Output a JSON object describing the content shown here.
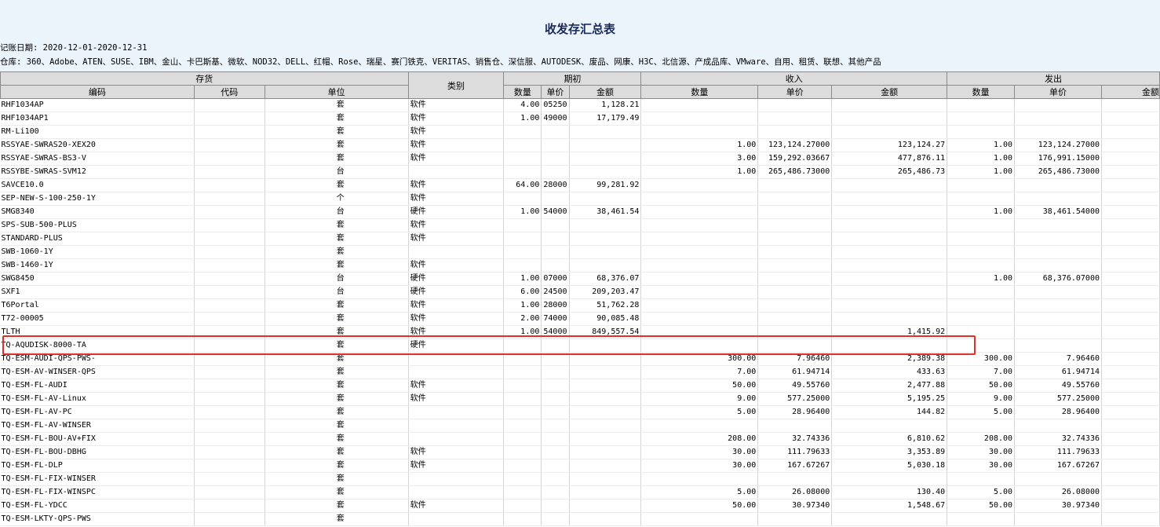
{
  "report": {
    "title": "收发存汇总表",
    "period": "记账日期: 2020-12-01-2020-12-31",
    "warehouses": "仓库: 360、Adobe、ATEN、SUSE、IBM、金山、卡巴斯基、微软、NOD32、DELL、红帽、Rose、瑞星、赛门铁克、VERITAS、销售仓、深信服、AUTODESK、废品、网康、H3C、北信源、产成品库、VMware、自用、租赁、联想、其他产品"
  },
  "headers": {
    "inventory": "存货",
    "category": "类别",
    "opening": "期初",
    "receipts": "收入",
    "issues": "发出",
    "code": "编码",
    "alias": "代码",
    "unit": "单位",
    "qty": "数量",
    "price": "单价",
    "amount": "金额"
  },
  "rows": [
    {
      "code": "RHF1034AP",
      "unit": "套",
      "category": "软件",
      "o_qty": "4.00",
      "o_price": "05250",
      "o_amt": "1,128.21",
      "r_qty": "",
      "r_price": "",
      "r_amt": "",
      "i_qty": "",
      "i_price": ""
    },
    {
      "code": "RHF1034AP1",
      "unit": "套",
      "category": "软件",
      "o_qty": "1.00",
      "o_price": "49000",
      "o_amt": "17,179.49",
      "r_qty": "",
      "r_price": "",
      "r_amt": "",
      "i_qty": "",
      "i_price": ""
    },
    {
      "code": "RM-Li100",
      "unit": "套",
      "category": "软件",
      "o_qty": "",
      "o_price": "",
      "o_amt": "",
      "r_qty": "",
      "r_price": "",
      "r_amt": "",
      "i_qty": "",
      "i_price": ""
    },
    {
      "code": "RSSYAE-SWRAS20-XEX20",
      "unit": "套",
      "category": "软件",
      "o_qty": "",
      "o_price": "",
      "o_amt": "",
      "r_qty": "1.00",
      "r_price": "123,124.27000",
      "r_amt": "123,124.27",
      "i_qty": "1.00",
      "i_price": "123,124.27000"
    },
    {
      "code": "RSSYAE-SWRAS-BS3-V",
      "unit": "套",
      "category": "软件",
      "o_qty": "",
      "o_price": "",
      "o_amt": "",
      "r_qty": "3.00",
      "r_price": "159,292.03667",
      "r_amt": "477,876.11",
      "i_qty": "1.00",
      "i_price": "176,991.15000"
    },
    {
      "code": "RSSYBE-SWRAS-SVM12",
      "unit": "台",
      "category": "",
      "o_qty": "",
      "o_price": "",
      "o_amt": "",
      "r_qty": "1.00",
      "r_price": "265,486.73000",
      "r_amt": "265,486.73",
      "i_qty": "1.00",
      "i_price": "265,486.73000"
    },
    {
      "code": "SAVCE10.0",
      "unit": "套",
      "category": "软件",
      "o_qty": "64.00",
      "o_price": "28000",
      "o_amt": "99,281.92",
      "r_qty": "",
      "r_price": "",
      "r_amt": "",
      "i_qty": "",
      "i_price": ""
    },
    {
      "code": "SEP-NEW-S-100-250-1Y",
      "unit": "个",
      "category": "软件",
      "o_qty": "",
      "o_price": "",
      "o_amt": "",
      "r_qty": "",
      "r_price": "",
      "r_amt": "",
      "i_qty": "",
      "i_price": ""
    },
    {
      "code": "SMG8340",
      "unit": "台",
      "category": "硬件",
      "o_qty": "1.00",
      "o_price": "54000",
      "o_amt": "38,461.54",
      "r_qty": "",
      "r_price": "",
      "r_amt": "",
      "i_qty": "1.00",
      "i_price": "38,461.54000"
    },
    {
      "code": "SPS-SUB-500-PLUS",
      "unit": "套",
      "category": "软件",
      "o_qty": "",
      "o_price": "",
      "o_amt": "",
      "r_qty": "",
      "r_price": "",
      "r_amt": "",
      "i_qty": "",
      "i_price": ""
    },
    {
      "code": "STANDARD-PLUS",
      "unit": "套",
      "category": "软件",
      "o_qty": "",
      "o_price": "",
      "o_amt": "",
      "r_qty": "",
      "r_price": "",
      "r_amt": "",
      "i_qty": "",
      "i_price": ""
    },
    {
      "code": "SWB-1060-1Y",
      "unit": "套",
      "category": "",
      "o_qty": "",
      "o_price": "",
      "o_amt": "",
      "r_qty": "",
      "r_price": "",
      "r_amt": "",
      "i_qty": "",
      "i_price": ""
    },
    {
      "code": "SWB-1460-1Y",
      "unit": "套",
      "category": "软件",
      "o_qty": "",
      "o_price": "",
      "o_amt": "",
      "r_qty": "",
      "r_price": "",
      "r_amt": "",
      "i_qty": "",
      "i_price": ""
    },
    {
      "code": "SWG8450",
      "unit": "台",
      "category": "硬件",
      "o_qty": "1.00",
      "o_price": "07000",
      "o_amt": "68,376.07",
      "r_qty": "",
      "r_price": "",
      "r_amt": "",
      "i_qty": "1.00",
      "i_price": "68,376.07000"
    },
    {
      "code": "SXF1",
      "unit": "台",
      "category": "硬件",
      "o_qty": "6.00",
      "o_price": "24500",
      "o_amt": "209,203.47",
      "r_qty": "",
      "r_price": "",
      "r_amt": "",
      "i_qty": "",
      "i_price": ""
    },
    {
      "code": "T6Portal",
      "unit": "套",
      "category": "软件",
      "o_qty": "1.00",
      "o_price": "28000",
      "o_amt": "51,762.28",
      "r_qty": "",
      "r_price": "",
      "r_amt": "",
      "i_qty": "",
      "i_price": ""
    },
    {
      "code": "T72-00005",
      "unit": "套",
      "category": "软件",
      "o_qty": "2.00",
      "o_price": "74000",
      "o_amt": "90,085.48",
      "r_qty": "",
      "r_price": "",
      "r_amt": "",
      "i_qty": "",
      "i_price": ""
    },
    {
      "code": "TLTH",
      "unit": "套",
      "category": "软件",
      "o_qty": "1.00",
      "o_price": "54000",
      "o_amt": "849,557.54",
      "r_qty": "",
      "r_price": "",
      "r_amt": "1,415.92",
      "i_qty": "",
      "i_price": ""
    },
    {
      "code": "TQ-AQUDISK-8000-TA",
      "unit": "套",
      "category": "硬件",
      "o_qty": "",
      "o_price": "",
      "o_amt": "",
      "r_qty": "",
      "r_price": "",
      "r_amt": "",
      "i_qty": "",
      "i_price": ""
    },
    {
      "code": "TQ-ESM-AUDI-QPS-PWS-",
      "unit": "套",
      "category": "",
      "o_qty": "",
      "o_price": "",
      "o_amt": "",
      "r_qty": "300.00",
      "r_price": "7.96460",
      "r_amt": "2,389.38",
      "i_qty": "300.00",
      "i_price": "7.96460"
    },
    {
      "code": "TQ-ESM-AV-WINSER-QPS",
      "unit": "套",
      "category": "",
      "o_qty": "",
      "o_price": "",
      "o_amt": "",
      "r_qty": "7.00",
      "r_price": "61.94714",
      "r_amt": "433.63",
      "i_qty": "7.00",
      "i_price": "61.94714"
    },
    {
      "code": "TQ-ESM-FL-AUDI",
      "unit": "套",
      "category": "软件",
      "o_qty": "",
      "o_price": "",
      "o_amt": "",
      "r_qty": "50.00",
      "r_price": "49.55760",
      "r_amt": "2,477.88",
      "i_qty": "50.00",
      "i_price": "49.55760"
    },
    {
      "code": "TQ-ESM-FL-AV-Linux",
      "unit": "套",
      "category": "软件",
      "o_qty": "",
      "o_price": "",
      "o_amt": "",
      "r_qty": "9.00",
      "r_price": "577.25000",
      "r_amt": "5,195.25",
      "i_qty": "9.00",
      "i_price": "577.25000"
    },
    {
      "code": "TQ-ESM-FL-AV-PC",
      "unit": "套",
      "category": "",
      "o_qty": "",
      "o_price": "",
      "o_amt": "",
      "r_qty": "5.00",
      "r_price": "28.96400",
      "r_amt": "144.82",
      "i_qty": "5.00",
      "i_price": "28.96400"
    },
    {
      "code": "TQ-ESM-FL-AV-WINSER",
      "unit": "套",
      "category": "",
      "o_qty": "",
      "o_price": "",
      "o_amt": "",
      "r_qty": "",
      "r_price": "",
      "r_amt": "",
      "i_qty": "",
      "i_price": ""
    },
    {
      "code": "TQ-ESM-FL-BOU-AV+FIX",
      "unit": "套",
      "category": "",
      "o_qty": "",
      "o_price": "",
      "o_amt": "",
      "r_qty": "208.00",
      "r_price": "32.74336",
      "r_amt": "6,810.62",
      "i_qty": "208.00",
      "i_price": "32.74336"
    },
    {
      "code": "TQ-ESM-FL-BOU-DBHG",
      "unit": "套",
      "category": "软件",
      "o_qty": "",
      "o_price": "",
      "o_amt": "",
      "r_qty": "30.00",
      "r_price": "111.79633",
      "r_amt": "3,353.89",
      "i_qty": "30.00",
      "i_price": "111.79633"
    },
    {
      "code": "TQ-ESM-FL-DLP",
      "unit": "套",
      "category": "软件",
      "o_qty": "",
      "o_price": "",
      "o_amt": "",
      "r_qty": "30.00",
      "r_price": "167.67267",
      "r_amt": "5,030.18",
      "i_qty": "30.00",
      "i_price": "167.67267"
    },
    {
      "code": "TQ-ESM-FL-FIX-WINSER",
      "unit": "套",
      "category": "",
      "o_qty": "",
      "o_price": "",
      "o_amt": "",
      "r_qty": "",
      "r_price": "",
      "r_amt": "",
      "i_qty": "",
      "i_price": ""
    },
    {
      "code": "TQ-ESM-FL-FIX-WINSPC",
      "unit": "套",
      "category": "",
      "o_qty": "",
      "o_price": "",
      "o_amt": "",
      "r_qty": "5.00",
      "r_price": "26.08000",
      "r_amt": "130.40",
      "i_qty": "5.00",
      "i_price": "26.08000"
    },
    {
      "code": "TQ-ESM-FL-YDCC",
      "unit": "套",
      "category": "软件",
      "o_qty": "",
      "o_price": "",
      "o_amt": "",
      "r_qty": "50.00",
      "r_price": "30.97340",
      "r_amt": "1,548.67",
      "i_qty": "50.00",
      "i_price": "30.97340"
    },
    {
      "code": "TQ-ESM-LKTY-QPS-PWS",
      "unit": "套",
      "category": "",
      "o_qty": "",
      "o_price": "",
      "o_amt": "",
      "r_qty": "",
      "r_price": "",
      "r_amt": "",
      "i_qty": "",
      "i_price": ""
    }
  ]
}
